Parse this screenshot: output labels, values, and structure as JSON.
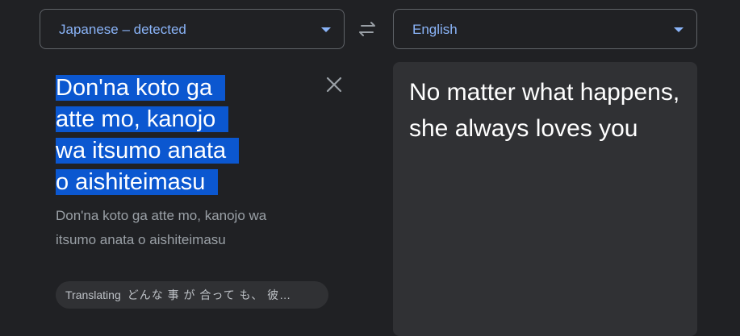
{
  "source_language": {
    "label": "Japanese – detected"
  },
  "target_language": {
    "label": "English"
  },
  "icons": {
    "swap": "swap-arrows-icon",
    "clear": "close-icon",
    "dropdown": "dropdown-arrow-icon"
  },
  "source": {
    "text_lines": [
      "Don'na koto ga",
      "atte mo, kanojo",
      "wa itsumo anata",
      "o aishiteimasu"
    ],
    "romanization": "Don'na koto ga atte mo, kanojo wa itsumo anata o aishiteimasu",
    "highlight_color": "#0b57d0"
  },
  "translating": {
    "label": "Translating",
    "text": "どんな 事 が 合って も、 彼…"
  },
  "target": {
    "text": "No matter what happens, she always loves you"
  },
  "colors": {
    "background": "#202124",
    "accent": "#8ab4f8",
    "panel": "#303134"
  }
}
